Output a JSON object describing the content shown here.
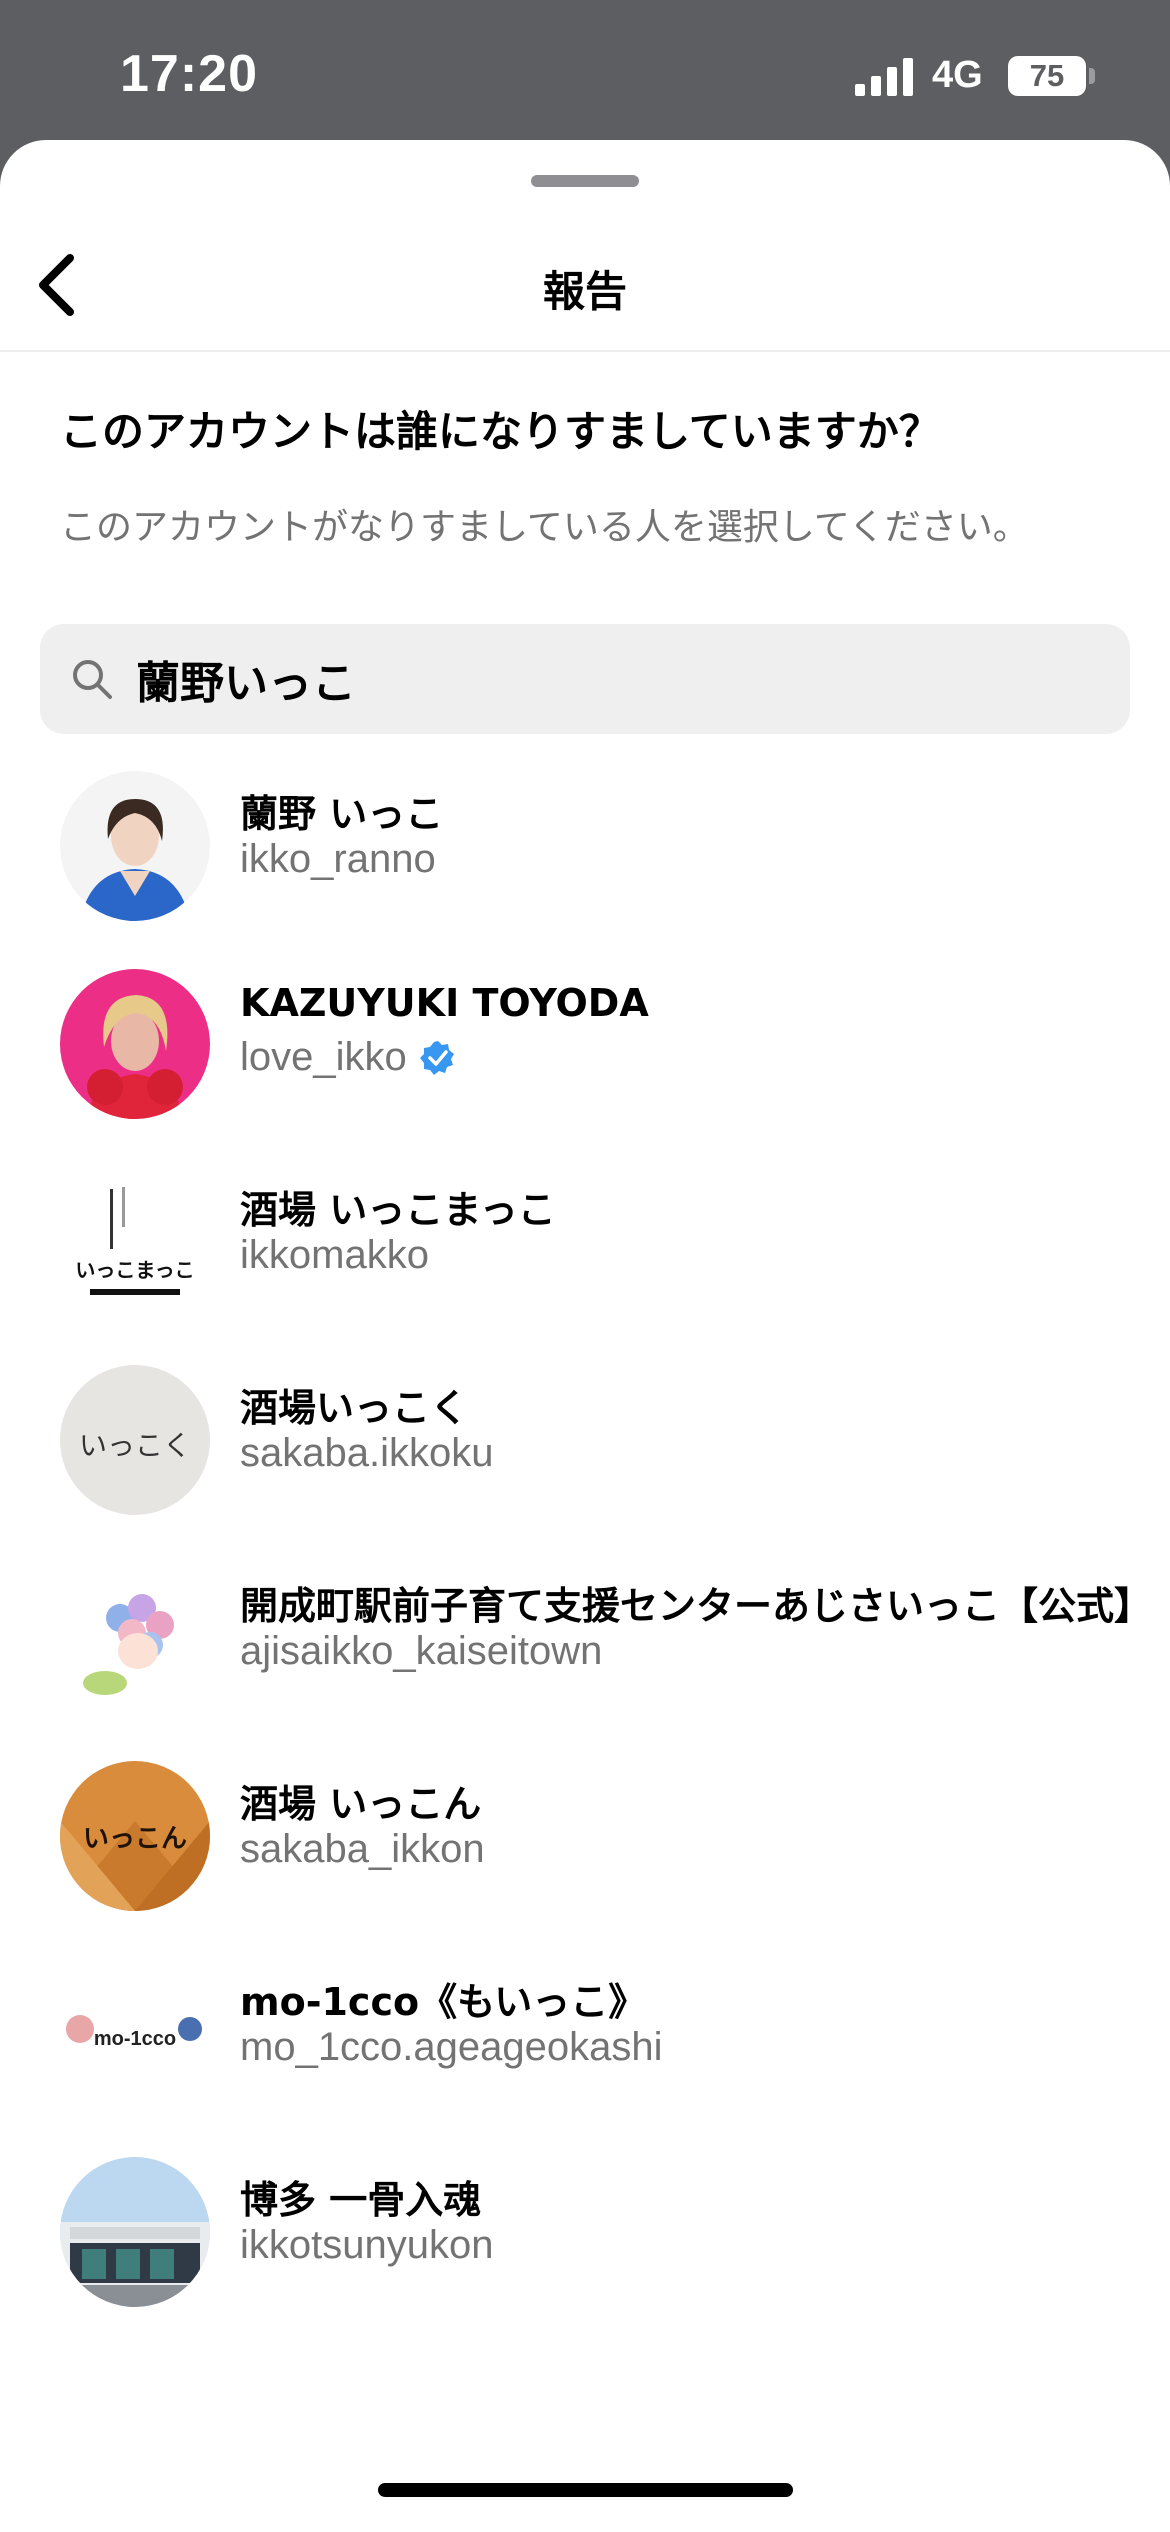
{
  "status_bar": {
    "time": "17:20",
    "network": "4G",
    "battery": "75"
  },
  "header": {
    "title": "報告"
  },
  "prompt": {
    "question": "このアカウントは誰になりすましていますか？",
    "instruction": "このアカウントがなりすましている人を選択してください。"
  },
  "search": {
    "value": "蘭野いっこ"
  },
  "results": [
    {
      "display_name": "蘭野 いっこ",
      "username": "ikko_ranno",
      "verified": false,
      "avatar_label": ""
    },
    {
      "display_name": "KAZUYUKI TOYODA",
      "username": "love_ikko",
      "verified": true,
      "avatar_label": ""
    },
    {
      "display_name": "酒場 いっこまっこ",
      "username": "ikkomakko",
      "verified": false,
      "avatar_label": "いっこまっこ"
    },
    {
      "display_name": "酒場いっこく",
      "username": "sakaba.ikkoku",
      "verified": false,
      "avatar_label": "いっこく"
    },
    {
      "display_name": "開成町駅前子育て支援センターあじさいっこ【公式】",
      "username": "ajisaikko_kaiseitown",
      "verified": false,
      "avatar_label": ""
    },
    {
      "display_name": "酒場 いっこん",
      "username": "sakaba_ikkon",
      "verified": false,
      "avatar_label": "いっこん"
    },
    {
      "display_name": "mo-1cco《もいっこ》",
      "username": "mo_1cco.ageageokashi",
      "verified": false,
      "avatar_label": "mo-1cco"
    },
    {
      "display_name": "博多 一骨入魂",
      "username": "ikkotsunyukon",
      "verified": false,
      "avatar_label": ""
    }
  ],
  "colors": {
    "status_bar_bg": "#5d5e62",
    "secondary_text": "#737373",
    "verified_blue": "#3897f0",
    "search_bg": "#efefef"
  },
  "icons": {
    "back": "chevron-left-icon",
    "search": "search-icon",
    "verified": "verified-badge-icon"
  }
}
